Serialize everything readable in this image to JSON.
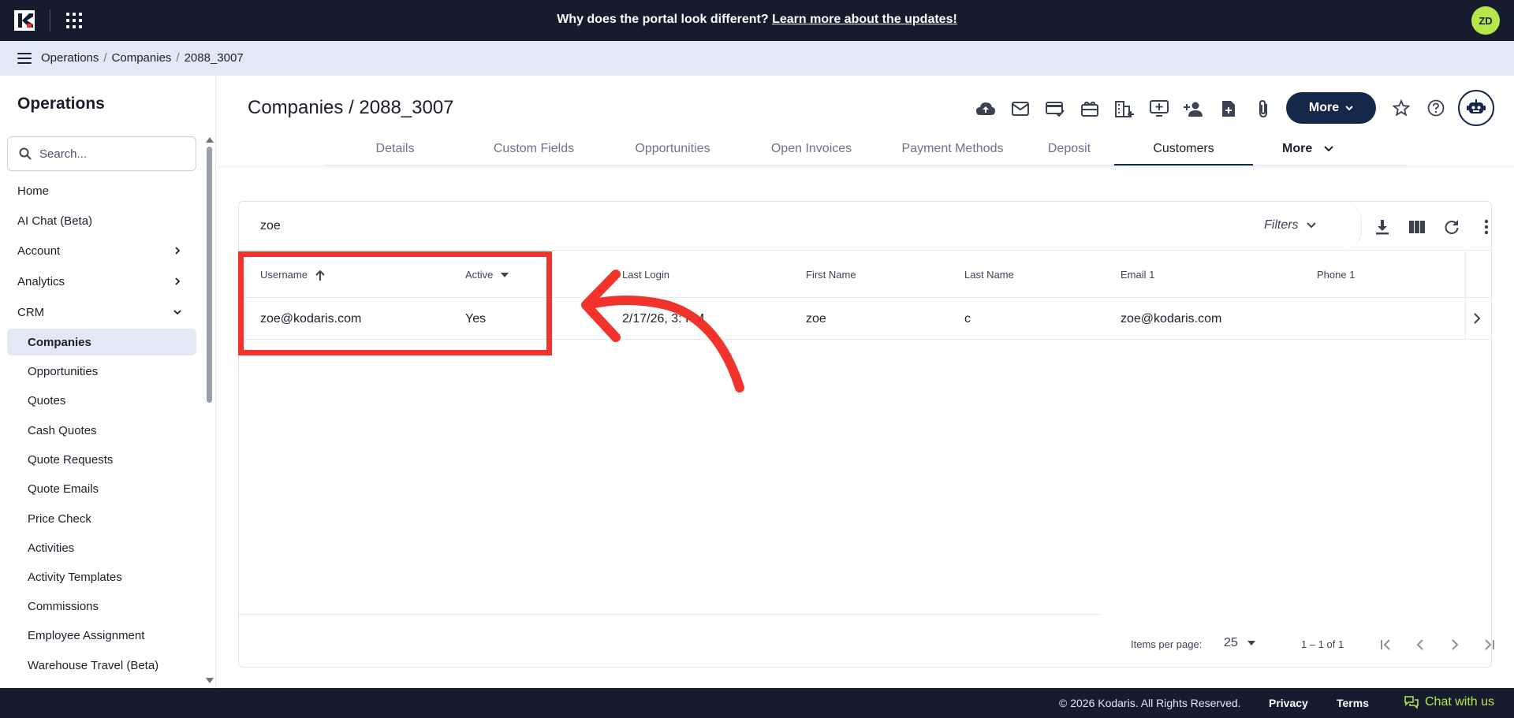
{
  "topbar": {
    "announcement": "Why does the portal look different?",
    "announcement_link": "Learn more about the updates!",
    "avatar_initials": "ZD"
  },
  "breadcrumb": [
    "Operations",
    "Companies",
    "2088_3007"
  ],
  "sidebar": {
    "title": "Operations",
    "search_placeholder": "Search...",
    "items": [
      {
        "label": "Home"
      },
      {
        "label": "AI Chat (Beta)"
      },
      {
        "label": "Account"
      },
      {
        "label": "Analytics"
      },
      {
        "label": "CRM"
      }
    ],
    "crm_items": [
      {
        "label": "Companies",
        "active": true
      },
      {
        "label": "Opportunities"
      },
      {
        "label": "Quotes"
      },
      {
        "label": "Cash Quotes"
      },
      {
        "label": "Quote Requests"
      },
      {
        "label": "Quote Emails"
      },
      {
        "label": "Price Check"
      },
      {
        "label": "Activities"
      },
      {
        "label": "Activity Templates"
      },
      {
        "label": "Commissions"
      },
      {
        "label": "Employee Assignment"
      },
      {
        "label": "Warehouse Travel (Beta)"
      }
    ]
  },
  "main": {
    "title": "Companies / 2088_3007",
    "more_button": "More",
    "tabs": [
      "Details",
      "Custom Fields",
      "Opportunities",
      "Open Invoices",
      "Payment Methods",
      "Deposit",
      "Customers"
    ],
    "active_tab": "Customers",
    "tabs_more": "More"
  },
  "grid": {
    "filter_text": "zoe",
    "filters_label": "Filters",
    "columns": [
      "Username",
      "Active",
      "Last Login",
      "First Name",
      "Last Name",
      "Email 1",
      "Phone 1"
    ],
    "rows": [
      {
        "username": "zoe@kodaris.com",
        "active": "Yes",
        "last_login": "2/17/26, 3:  PM",
        "first_name": "zoe",
        "last_name": "c",
        "email1": "zoe@kodaris.com",
        "phone1": ""
      }
    ],
    "items_per_page_label": "Items per page:",
    "items_per_page": "25",
    "range": "1 – 1 of 1"
  },
  "footer": {
    "copyright": "© 2026 Kodaris. All Rights Reserved.",
    "privacy": "Privacy",
    "terms": "Terms",
    "chat": "Chat with us"
  },
  "colors": {
    "navbar": "#141c2e",
    "accent_navy": "#16284a",
    "lime": "#b7e64a",
    "annotation_red": "#f2332b"
  }
}
